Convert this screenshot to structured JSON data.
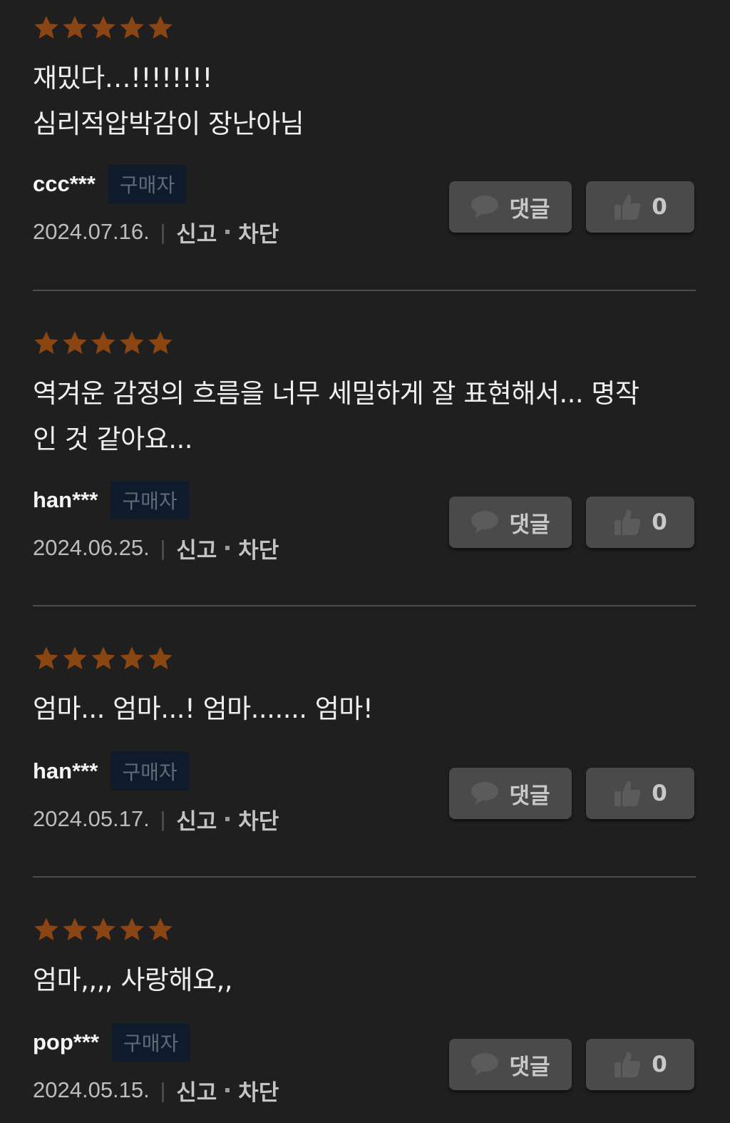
{
  "colors": {
    "background": "#1f1f1f",
    "star": "#8b4513",
    "badge_bg": "#0f1b2a",
    "button_bg": "#4a4a4a"
  },
  "icons": {
    "rating": "star-icon",
    "comment": "speech-bubble-icon",
    "like": "thumbs-up-icon"
  },
  "reviews": [
    {
      "rating": 5,
      "text": "재밌다…!!!!!!!!\n심리적압박감이 장난아님",
      "user": "ccc***",
      "badge": "구매자",
      "date": "2024.07.16.",
      "separator": "|",
      "report_label": "신고",
      "block_label": "차단",
      "comment_label": "댓글",
      "like_count": "0"
    },
    {
      "rating": 5,
      "text": "역겨운 감정의 흐름을 너무 세밀하게 잘 표현해서... 명작\n인 것 같아요...",
      "user": "han***",
      "badge": "구매자",
      "date": "2024.06.25.",
      "separator": "|",
      "report_label": "신고",
      "block_label": "차단",
      "comment_label": "댓글",
      "like_count": "0"
    },
    {
      "rating": 5,
      "text": "엄마... 엄마...! 엄마....... 엄마!",
      "user": "han***",
      "badge": "구매자",
      "date": "2024.05.17.",
      "separator": "|",
      "report_label": "신고",
      "block_label": "차단",
      "comment_label": "댓글",
      "like_count": "0"
    },
    {
      "rating": 5,
      "text": "엄마,,,, 사랑해요,,",
      "user": "pop***",
      "badge": "구매자",
      "date": "2024.05.15.",
      "separator": "|",
      "report_label": "신고",
      "block_label": "차단",
      "comment_label": "댓글",
      "like_count": "0"
    }
  ]
}
